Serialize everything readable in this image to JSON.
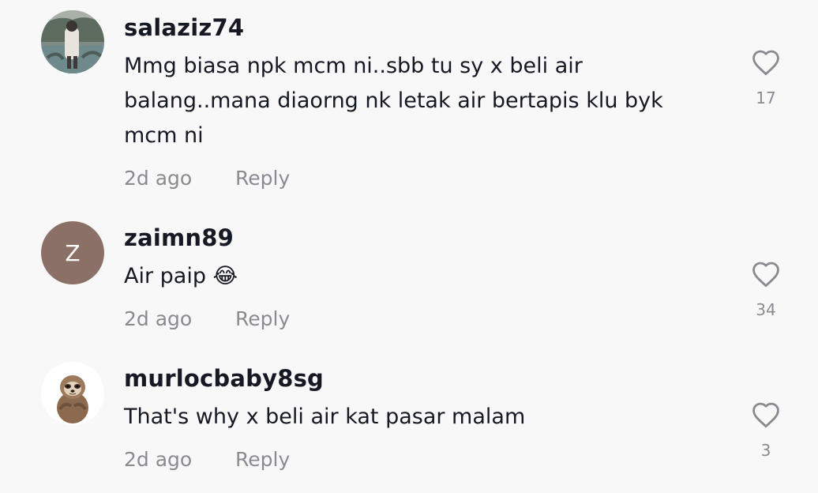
{
  "comments": [
    {
      "username": "salaziz74",
      "text": "Mmg biasa npk mcm ni..sbb tu sy x beli air balang..mana diaorng nk letak air bertapis klu byk mcm ni",
      "time": "2d ago",
      "reply_label": "Reply",
      "likes": "17",
      "avatar": {
        "type": "photo"
      }
    },
    {
      "username": "zaimn89",
      "text": "Air paip 😂",
      "time": "2d ago",
      "reply_label": "Reply",
      "likes": "34",
      "avatar": {
        "type": "initial",
        "initial": "Z",
        "color": "#8a7066"
      }
    },
    {
      "username": "murlocbaby8sg",
      "text": "That's why x beli air kat pasar malam",
      "time": "2d ago",
      "reply_label": "Reply",
      "likes": "3",
      "avatar": {
        "type": "illustration",
        "icon": "sloth-icon"
      }
    }
  ],
  "colors": {
    "background": "#f8f8f8",
    "text": "#161823",
    "muted": "#8a8b91",
    "heart_outline": "#8a8b91"
  }
}
